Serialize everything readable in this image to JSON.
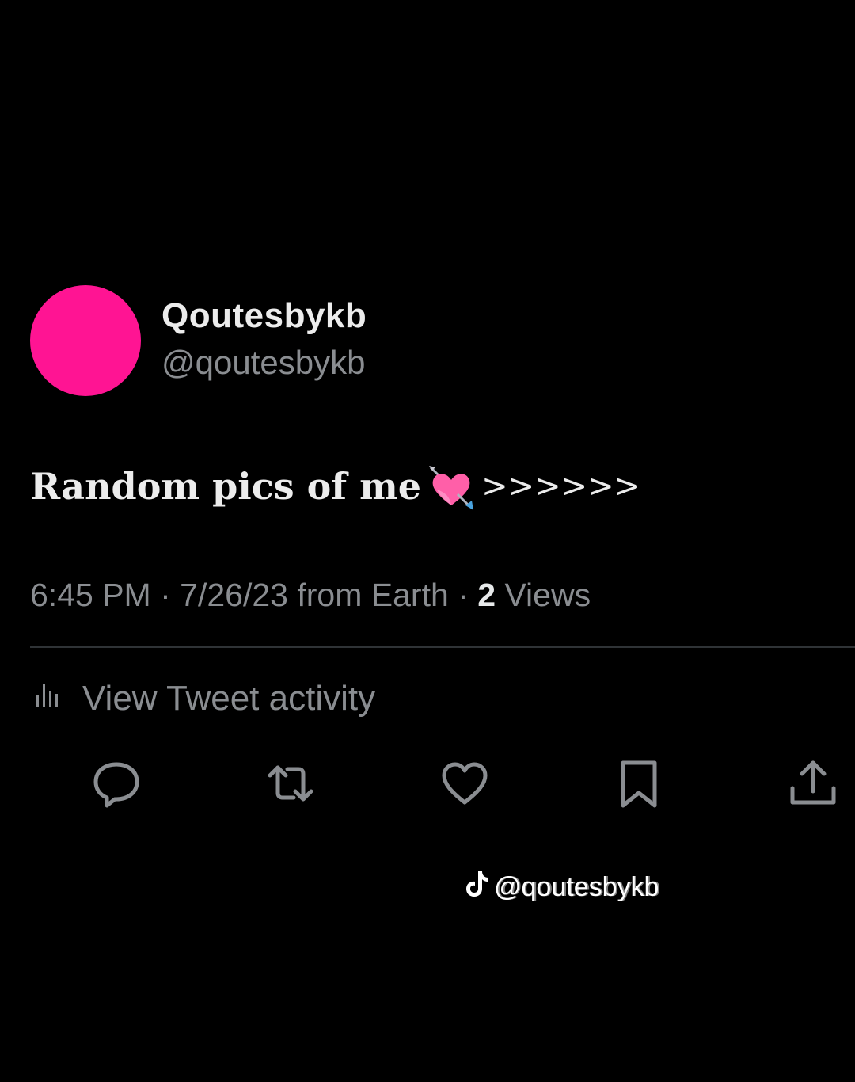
{
  "tweet": {
    "display_name": "Qoutesbykb",
    "handle": "@qoutesbykb",
    "text": "Random pics of me",
    "emoji": "heart-with-arrow-icon",
    "text_suffix": ">>>>>>",
    "time": "6:45 PM",
    "date": "7/26/23",
    "source": "from Earth",
    "separator": "·",
    "views_count": "2",
    "views_label": "Views"
  },
  "activity": {
    "label": "View Tweet activity",
    "icon": "bar-chart-icon"
  },
  "actions": [
    {
      "name": "reply",
      "icon": "reply-icon"
    },
    {
      "name": "retweet",
      "icon": "retweet-icon"
    },
    {
      "name": "like",
      "icon": "heart-icon"
    },
    {
      "name": "bookmark",
      "icon": "bookmark-icon"
    },
    {
      "name": "share",
      "icon": "share-icon"
    }
  ],
  "watermark": {
    "icon": "tiktok-icon",
    "text": "@qoutesbykb"
  },
  "colors": {
    "background": "#000000",
    "avatar": "#ff1493",
    "primary_text": "#e7e9ea",
    "secondary_text": "#8a8d91",
    "divider": "#2f3336"
  }
}
